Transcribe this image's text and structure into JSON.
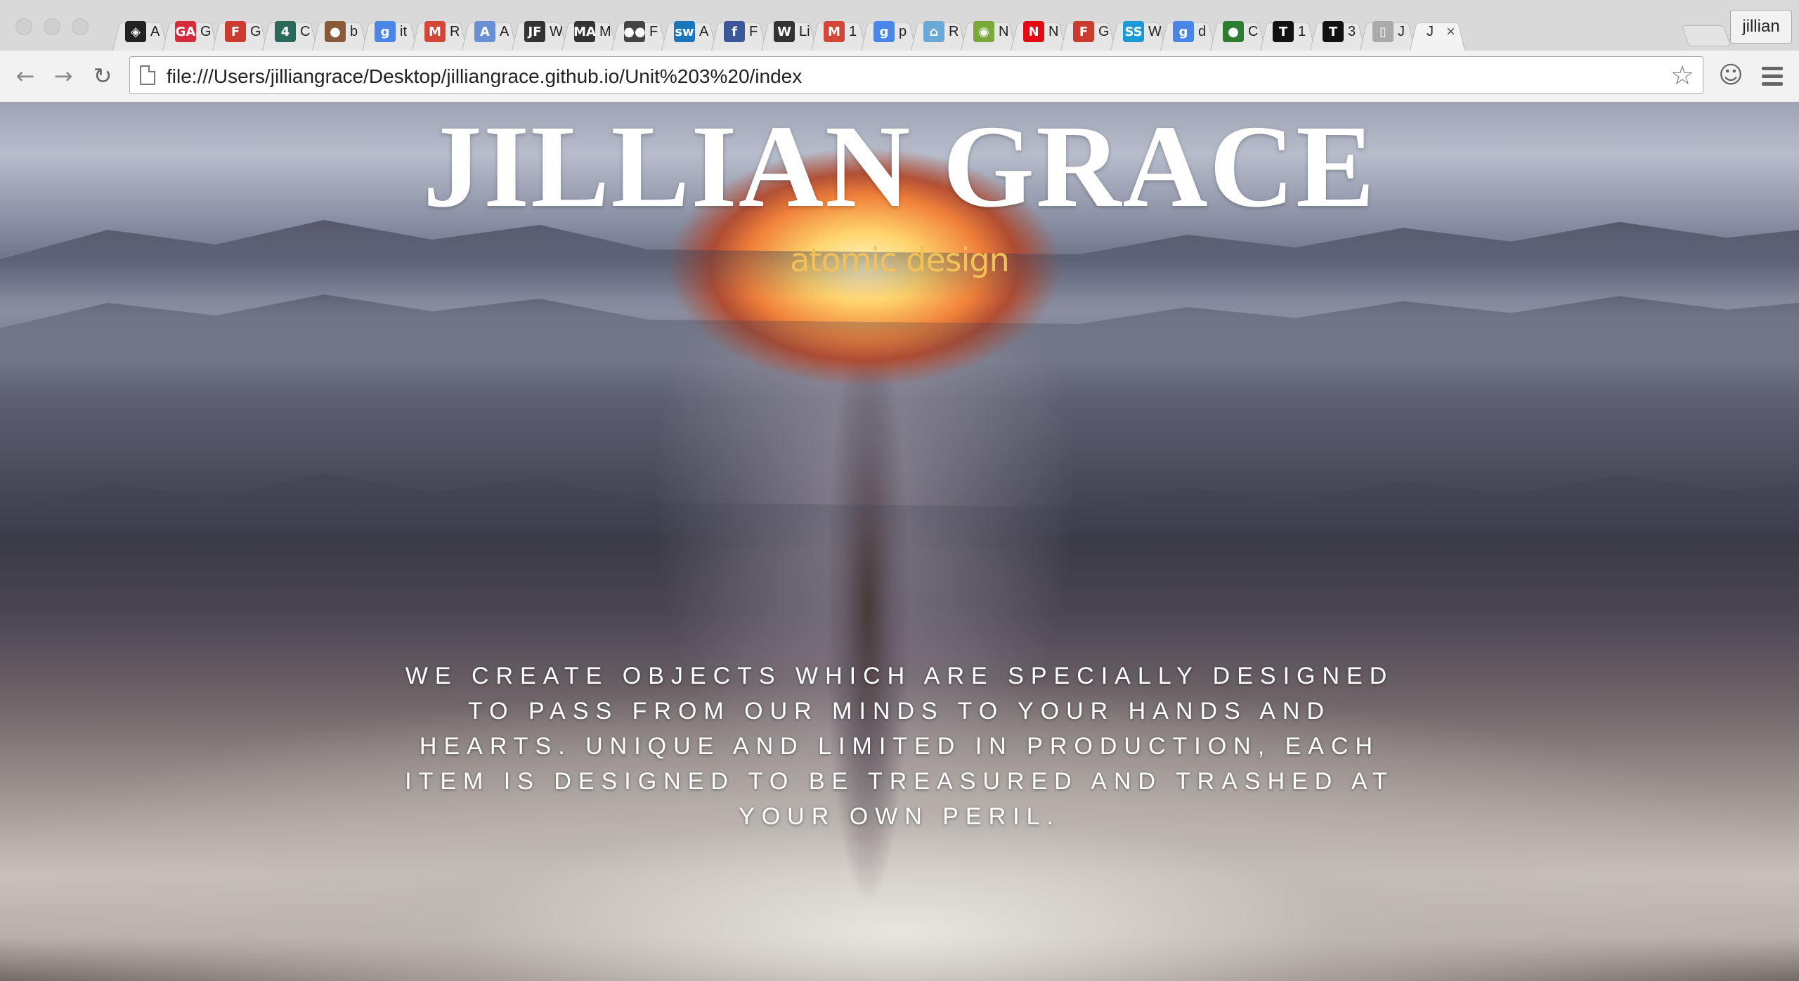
{
  "browser": {
    "tabs": [
      {
        "icon": "codepen-icon",
        "title": "A",
        "color": "#222222",
        "glyph": "◈"
      },
      {
        "icon": "ga-icon",
        "title": "G",
        "color": "#d62b3b",
        "glyph": "GA"
      },
      {
        "icon": "fontfile-icon",
        "title": "G",
        "color": "#c93c2f",
        "glyph": "F"
      },
      {
        "icon": "channel4-icon",
        "title": "C",
        "color": "#2b6a5a",
        "glyph": "4"
      },
      {
        "icon": "avatar-icon",
        "title": "b",
        "color": "#8a5a3a",
        "glyph": "●"
      },
      {
        "icon": "google-icon",
        "title": "it",
        "color": "#4a86e8",
        "glyph": "g"
      },
      {
        "icon": "gmail-icon",
        "title": "R",
        "color": "#d44638",
        "glyph": "M"
      },
      {
        "icon": "font-a-icon",
        "title": "A",
        "color": "#6b8fd4",
        "glyph": "A"
      },
      {
        "icon": "jf-icon",
        "title": "W",
        "color": "#333333",
        "glyph": "JF"
      },
      {
        "icon": "mam-icon",
        "title": "M",
        "color": "#333333",
        "glyph": "MA"
      },
      {
        "icon": "flickr-icon",
        "title": "F",
        "color": "#444444",
        "glyph": "●●"
      },
      {
        "icon": "sw-icon",
        "title": "A",
        "color": "#1b75bb",
        "glyph": "sw"
      },
      {
        "icon": "facebook-icon",
        "title": "F",
        "color": "#3b5998",
        "glyph": "f"
      },
      {
        "icon": "wikipedia-icon",
        "title": "Li",
        "color": "#333333",
        "glyph": "W"
      },
      {
        "icon": "gmail-icon",
        "title": "1",
        "color": "#d44638",
        "glyph": "M"
      },
      {
        "icon": "google-icon",
        "title": "p",
        "color": "#4a86e8",
        "glyph": "g"
      },
      {
        "icon": "home-icon",
        "title": "R",
        "color": "#6aa8d8",
        "glyph": "⌂"
      },
      {
        "icon": "owl-icon",
        "title": "N",
        "color": "#7aa83a",
        "glyph": "◉"
      },
      {
        "icon": "netflix-icon",
        "title": "N",
        "color": "#e50914",
        "glyph": "N"
      },
      {
        "icon": "fontfile-icon",
        "title": "G",
        "color": "#c93c2f",
        "glyph": "F"
      },
      {
        "icon": "ss-icon",
        "title": "W",
        "color": "#1a9bd7",
        "glyph": "SS"
      },
      {
        "icon": "google-icon",
        "title": "d",
        "color": "#4a86e8",
        "glyph": "g"
      },
      {
        "icon": "silhouette-icon",
        "title": "C",
        "color": "#2e7d32",
        "glyph": "●"
      },
      {
        "icon": "t-icon",
        "title": "1",
        "color": "#111111",
        "glyph": "T"
      },
      {
        "icon": "t-icon",
        "title": "3",
        "color": "#111111",
        "glyph": "T"
      },
      {
        "icon": "page-icon",
        "title": "J",
        "color": "#aaaaaa",
        "glyph": "▯"
      },
      {
        "icon": "",
        "title": "J",
        "color": "",
        "glyph": "",
        "active": true
      }
    ],
    "profile_name": "jillian",
    "url": "file:///Users/jilliangrace/Desktop/jilliangrace.github.io/Unit%203%20/index"
  },
  "page": {
    "title": "JILLIAN GRACE",
    "subtitle": "atomic design",
    "tagline": "WE CREATE OBJECTS WHICH ARE SPECIALLY DESIGNED TO PASS FROM OUR MINDS TO YOUR HANDS AND HEARTS. UNIQUE AND LIMITED IN PRODUCTION, EACH ITEM IS DESIGNED TO BE TREASURED AND TRASHED AT YOUR OWN PERIL."
  }
}
